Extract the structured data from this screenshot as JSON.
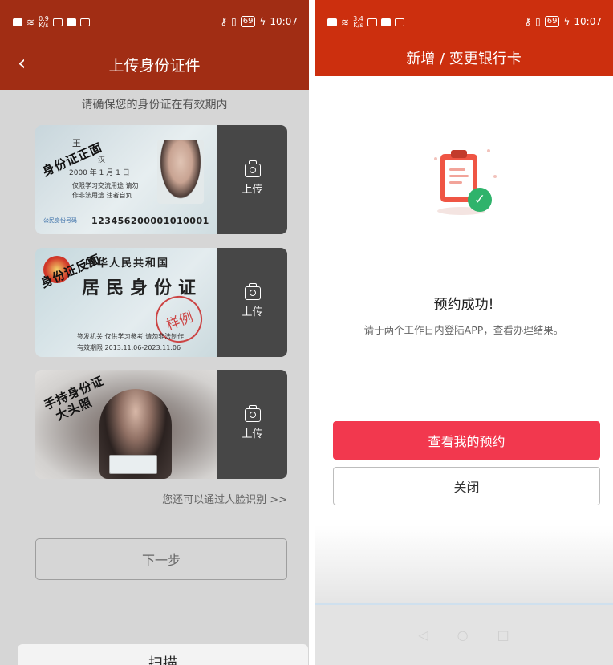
{
  "left_screen": {
    "status": {
      "speed_value": "0.9",
      "speed_unit": "K/s",
      "battery": "69",
      "time": "10:07"
    },
    "title": "上传身份证件",
    "hint": "请确保您的身份证在有效期内",
    "cards": [
      {
        "stamp": "身份证正面",
        "upload_label": "上传",
        "name_value": "王",
        "ethnicity_value": "汉",
        "birth_year": "2000",
        "birth_month": "1",
        "birth_day": "1",
        "address_line1": "仅限学习交流用途 请勿",
        "address_line2": "作非法用途 违者自负",
        "id_label": "公民身份号码",
        "id_number": "123456200001010001"
      },
      {
        "stamp": "身份证反面",
        "upload_label": "上传",
        "country": "中华人民共和国",
        "card_title": "居民身份证",
        "seal_text": "样例",
        "authority": "签发机关  仅供学习参考 请勿非法制作",
        "validity": "有效期限  2013.11.06-2023.11.06"
      },
      {
        "stamp_line1": "手持身份证",
        "stamp_line2": "大头照",
        "upload_label": "上传"
      }
    ],
    "face_link": "您还可以通过人脸识别 >>",
    "next_button": "下一步",
    "sheet_label": "扫描"
  },
  "right_screen": {
    "status": {
      "speed_value": "3.4",
      "speed_unit": "K/s",
      "battery": "69",
      "time": "10:07"
    },
    "title": "新增 / 变更银行卡",
    "success_title": "预约成功!",
    "success_sub": "请于两个工作日内登陆APP，查看办理结果。",
    "primary_button": "查看我的预约",
    "close_button": "关闭"
  },
  "icons": {
    "back": "chevron-left-icon",
    "camera": "camera-icon",
    "clipboard": "clipboard-check-icon",
    "nav": [
      "back-nav-icon",
      "home-nav-icon",
      "recent-nav-icon"
    ]
  },
  "colors": {
    "left_header": "#a12d14",
    "right_header": "#cc2f0e",
    "primary_button": "#f2384e",
    "upload_panel": "#474747",
    "check_green": "#2fb36b"
  }
}
